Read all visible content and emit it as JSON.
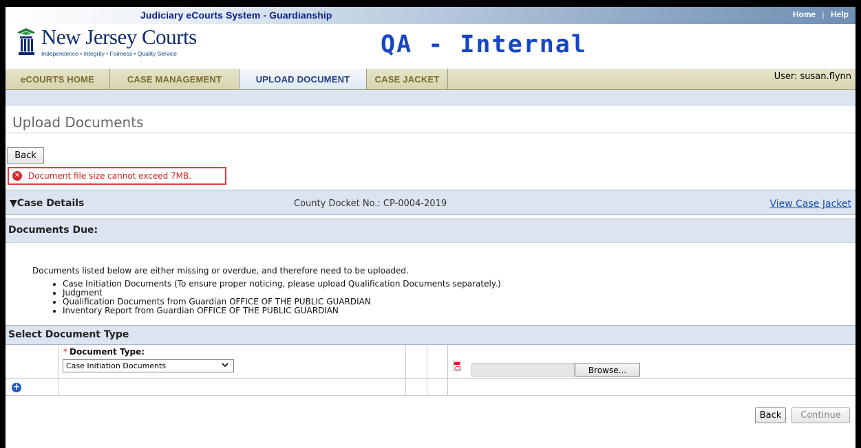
{
  "app": {
    "system_title": "Judiciary eCourts System - Guardianship",
    "top_links": {
      "home": "Home",
      "separator": "|",
      "help": "Help"
    },
    "logo": {
      "title": "New Jersey Courts",
      "tagline": "Independence • Integrity • Fairness • Quality Service"
    },
    "environment": "QA - Internal"
  },
  "nav": {
    "tabs": [
      {
        "label": "eCOURTS HOME",
        "active": false
      },
      {
        "label": "CASE MANAGEMENT",
        "active": false
      },
      {
        "label": "UPLOAD DOCUMENT",
        "active": true
      },
      {
        "label": "CASE JACKET",
        "active": false
      }
    ],
    "user": "User: susan.flynn"
  },
  "page": {
    "title": "Upload Documents",
    "back_label": "Back",
    "error_message": "Document file size cannot exceed 7MB."
  },
  "case_details": {
    "header": "▼Case Details",
    "docket": "County Docket No.: CP-0004-2019",
    "view_link": "View Case Jacket"
  },
  "documents_due": {
    "header": "Documents Due:",
    "intro": "Documents listed below are either missing or overdue, and therefore need to be uploaded.",
    "items": [
      "Case Initiation Documents (To ensure proper noticing, please upload Qualification Documents separately.)",
      "Judgment",
      "Qualification Documents from Guardian OFFICE OF THE PUBLIC GUARDIAN",
      "Inventory Report from Guardian OFFICE OF THE PUBLIC GUARDIAN"
    ]
  },
  "select_document": {
    "header": "Select Document Type",
    "required_mark": "*",
    "label": "Document Type:",
    "selected": "Case Initiation Documents",
    "browse_label": "Browse...",
    "file_value": ""
  },
  "footer_buttons": {
    "back": "Back",
    "continue": "Continue"
  },
  "colors": {
    "env_blue": "#1646c8",
    "error_red": "#d42020",
    "section_bg": "#dce4ef",
    "nav_bg": "#e7e4c9",
    "link_blue": "#1650b4"
  },
  "icons": [
    "error-icon",
    "pdf-icon",
    "add-icon",
    "chevron-down-icon",
    "nj-courts-logo-icon"
  ]
}
